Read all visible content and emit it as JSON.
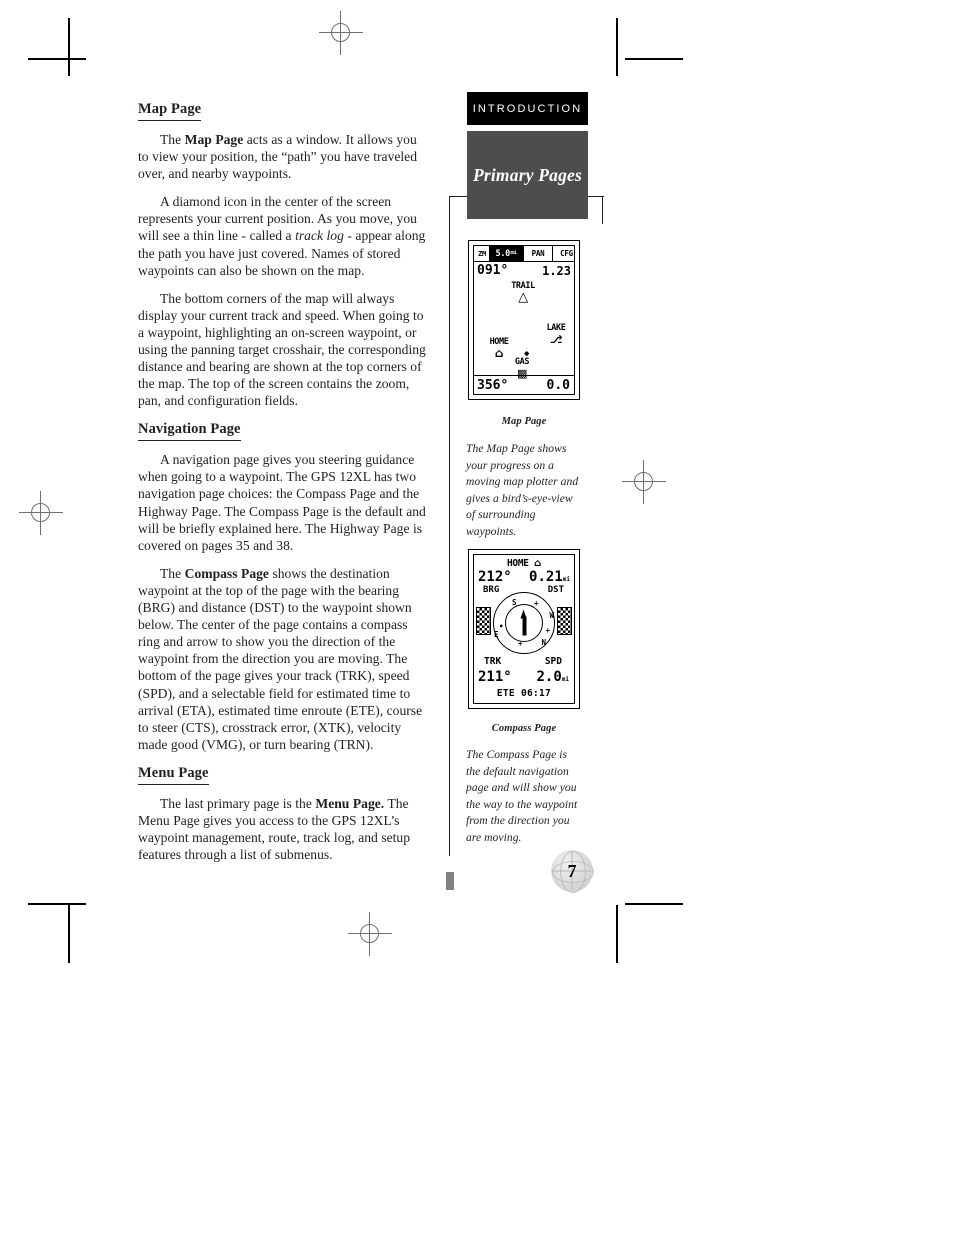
{
  "page": {
    "folio": "7",
    "section_tab": "INTRODUCTION",
    "section_title": "Primary Pages"
  },
  "main": {
    "sections": [
      {
        "heading": "Map Page",
        "paragraphs": [
          "The Map Page acts as a window. It allows you to view your position, the “path” you have traveled over, and nearby waypoints.",
          "A diamond icon in the center of the screen represents your current position. As you move, you will see a thin line - called a track log - appear along the path you have just covered. Names of stored waypoints can also be shown on the map.",
          "The bottom corners of the map will always display your current track and speed. When going to a waypoint, highlighting an on-screen waypoint, or using the panning target crosshair, the corresponding distance and bearing are shown at the top corners of the map. The top of the screen contains the zoom, pan, and configuration fields."
        ]
      },
      {
        "heading": "Navigation Page",
        "paragraphs": [
          "A navigation page gives you steering guidance when going to a waypoint. The GPS 12XL has two navigation page choices: the Compass Page and the Highway Page. The Compass Page is the default and will be briefly explained here. The Highway Page is covered on pages 35 and 38.",
          "The Compass Page shows the destination waypoint at the top of the page with the bearing (BRG) and distance (DST) to the waypoint shown below. The center of the page contains a compass ring and arrow to show you the direction of the waypoint from the direction you are moving. The bottom of the page gives your track (TRK), speed (SPD), and a selectable field for estimated time to arrival (ETA), estimated time enroute (ETE), course to steer (CTS), crosstrack error, (XTK), velocity made good (VMG), or turn bearing (TRN)."
        ]
      },
      {
        "heading": "Menu Page",
        "paragraphs": [
          "The last primary page is the Menu Page. The Menu Page gives you access to the GPS 12XL’s waypoint management, route, track log, and setup features through a list of submenus."
        ]
      }
    ]
  },
  "figures": [
    {
      "title": "Map Page",
      "caption": "The Map Page shows your progress on a moving map plotter and gives a bird’s-eye-view of surrounding waypoints.",
      "screen": {
        "zoom_label": "ZM",
        "zoom_value": "5.0",
        "zoom_unit": "mi",
        "pan_field": "PAN",
        "cfg_field": "CFG",
        "bearing_top": "091°",
        "distance_top": "1.23",
        "track_bottom": "356°",
        "speed_bottom": "0.0",
        "waypoints": [
          {
            "name": "TRAIL",
            "icon": "tent-icon"
          },
          {
            "name": "LAKE",
            "icon": "boat-icon"
          },
          {
            "name": "HOME",
            "icon": "house-icon"
          },
          {
            "name": "GAS",
            "icon": "fuel-pump-icon"
          }
        ],
        "position_marker": "diamond-icon"
      }
    },
    {
      "title": "Compass Page",
      "caption": "The Compass Page is the default navigation page and will show you the way to the waypoint from the direction you are moving.",
      "screen": {
        "destination": "HOME",
        "destination_icon": "house-icon",
        "brg_value": "212°",
        "dst_value": "0.21",
        "dst_unit": "mi",
        "brg_label": "BRG",
        "dst_label": "DST",
        "trk_label": "TRK",
        "spd_label": "SPD",
        "trk_value": "211°",
        "spd_value": "2.0",
        "spd_unit": "mi",
        "ete_label": "ETE",
        "ete_value": "06:17",
        "compass_points": [
          "N",
          "E",
          "S",
          "W"
        ]
      }
    }
  ],
  "colors": {
    "tab_black": "#000000",
    "tab_gray": "#4d4d4f",
    "text": "#231f20",
    "rule": "#231f20"
  }
}
